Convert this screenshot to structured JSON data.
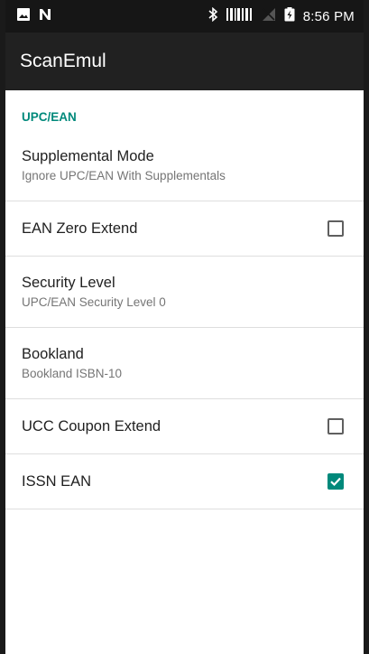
{
  "status_bar": {
    "time": "8:56 PM",
    "icons": [
      "image-icon",
      "notification-n-icon",
      "bluetooth-icon",
      "barcode-icon",
      "no-signal-icon",
      "battery-charging-icon"
    ]
  },
  "app_bar": {
    "title": "ScanEmul"
  },
  "colors": {
    "accent": "#00897b",
    "status_bar": "#161616",
    "app_bar": "#212121"
  },
  "category": {
    "label": "UPC/EAN"
  },
  "preferences": [
    {
      "title": "Supplemental Mode",
      "summary": "Ignore UPC/EAN With Supplementals"
    },
    {
      "title": "EAN Zero Extend",
      "checked": false
    },
    {
      "title": "Security Level",
      "summary": "UPC/EAN Security Level 0"
    },
    {
      "title": "Bookland",
      "summary": "Bookland ISBN-10"
    },
    {
      "title": "UCC Coupon Extend",
      "checked": false
    },
    {
      "title": "ISSN EAN",
      "checked": true
    }
  ]
}
